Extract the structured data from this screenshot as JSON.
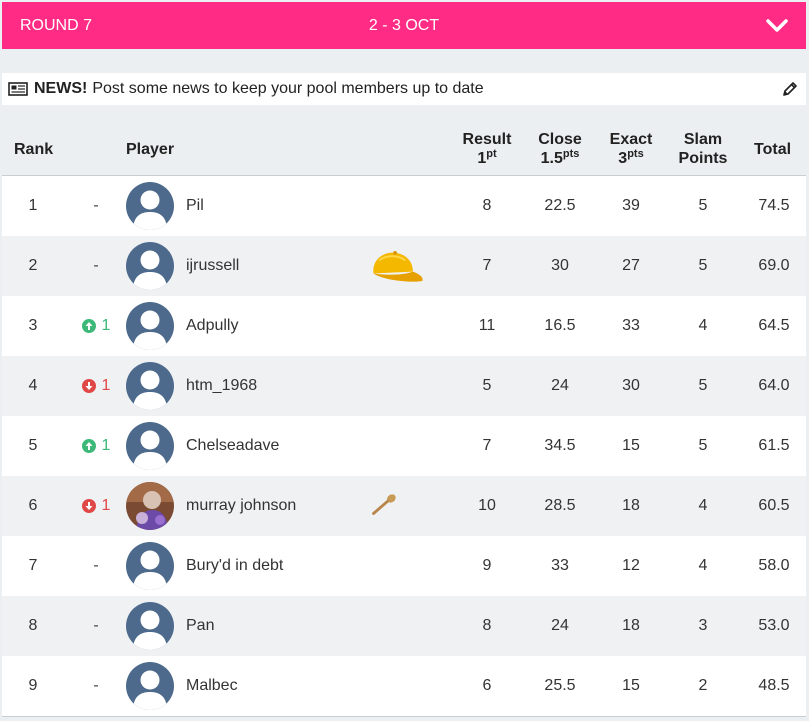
{
  "round": {
    "label": "ROUND 7",
    "dates": "2 - 3 OCT"
  },
  "news": {
    "bold": "NEWS!",
    "text": "Post some news to keep your pool members up to date"
  },
  "headers": {
    "rank": "Rank",
    "player": "Player",
    "result_l1": "Result",
    "result_l2": "1",
    "result_sup": "pt",
    "close_l1": "Close",
    "close_l2": "1.5",
    "close_sup": "pts",
    "exact_l1": "Exact",
    "exact_l2": "3",
    "exact_sup": "pts",
    "slam_l1": "Slam",
    "slam_l2": "Points",
    "total": "Total"
  },
  "rows": [
    {
      "rank": "1",
      "move": "same",
      "move_text": "-",
      "name": "Pil",
      "avatar": "default",
      "trophy": "",
      "result": "8",
      "close": "22.5",
      "exact": "39",
      "slam": "5",
      "total": "74.5"
    },
    {
      "rank": "2",
      "move": "same",
      "move_text": "-",
      "name": "ijrussell",
      "avatar": "default",
      "trophy": "cap-icon",
      "result": "7",
      "close": "30",
      "exact": "27",
      "slam": "5",
      "total": "69.0"
    },
    {
      "rank": "3",
      "move": "up",
      "move_text": "1",
      "name": "Adpully",
      "avatar": "default",
      "trophy": "",
      "result": "11",
      "close": "16.5",
      "exact": "33",
      "slam": "4",
      "total": "64.5"
    },
    {
      "rank": "4",
      "move": "down",
      "move_text": "1",
      "name": "htm_1968",
      "avatar": "default",
      "trophy": "",
      "result": "5",
      "close": "24",
      "exact": "30",
      "slam": "5",
      "total": "64.0"
    },
    {
      "rank": "5",
      "move": "up",
      "move_text": "1",
      "name": "Chelseadave",
      "avatar": "default",
      "trophy": "",
      "result": "7",
      "close": "34.5",
      "exact": "15",
      "slam": "5",
      "total": "61.5"
    },
    {
      "rank": "6",
      "move": "down",
      "move_text": "1",
      "name": "murray johnson",
      "avatar": "photo",
      "trophy": "spoon-icon",
      "result": "10",
      "close": "28.5",
      "exact": "18",
      "slam": "4",
      "total": "60.5"
    },
    {
      "rank": "7",
      "move": "same",
      "move_text": "-",
      "name": "Bury'd in debt",
      "avatar": "default",
      "trophy": "",
      "result": "9",
      "close": "33",
      "exact": "12",
      "slam": "4",
      "total": "58.0"
    },
    {
      "rank": "8",
      "move": "same",
      "move_text": "-",
      "name": "Pan",
      "avatar": "default",
      "trophy": "",
      "result": "8",
      "close": "24",
      "exact": "18",
      "slam": "3",
      "total": "53.0"
    },
    {
      "rank": "9",
      "move": "same",
      "move_text": "-",
      "name": "Malbec",
      "avatar": "default",
      "trophy": "",
      "result": "6",
      "close": "25.5",
      "exact": "15",
      "slam": "2",
      "total": "48.5"
    }
  ],
  "colors": {
    "accent": "#ff2b85",
    "up": "#3cb878",
    "down": "#e04848",
    "avatar": "#4d6a8c"
  }
}
